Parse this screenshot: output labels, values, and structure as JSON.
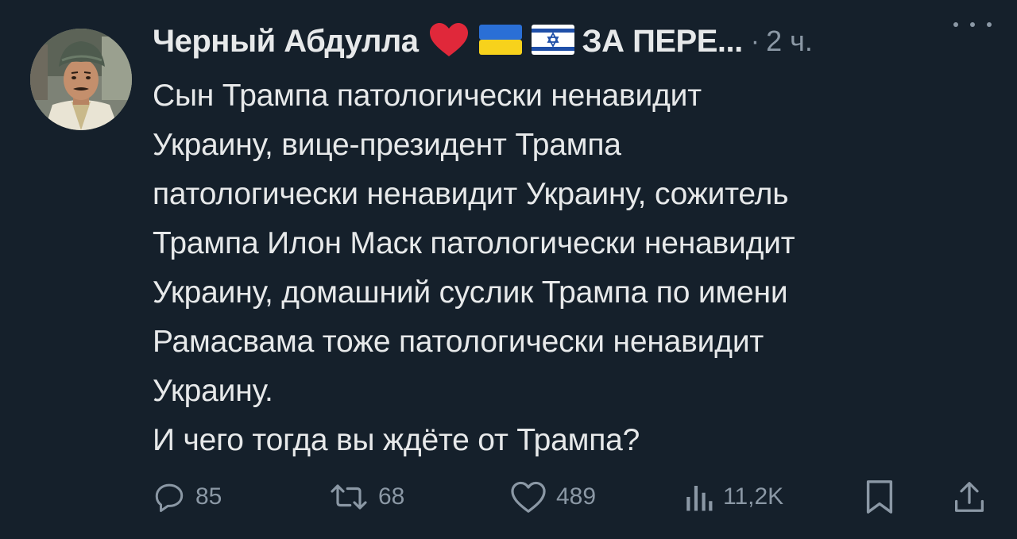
{
  "author": {
    "display_name": "Черный Абдулла",
    "name_suffix": "ЗА ПЕРЕ...",
    "name_emojis": [
      "red-heart",
      "ukraine-flag",
      "israel-flag"
    ],
    "avatar": "man-in-turban-photo"
  },
  "meta": {
    "separator": "·",
    "timestamp": "2 ч."
  },
  "tweet_text": "Сын Трампа патологически ненавидит\nУкраину, вице-президент Трампа\nпатологически ненавидит Украину, сожитель\nТрампа Илон Маск патологически ненавидит\nУкраину, домашний суслик Трампа по имени\nРамасвама тоже патологически ненавидит\nУкраину.\nИ чего тогда вы ждёте от Трампа?",
  "actions": {
    "reply": {
      "icon": "reply-icon",
      "count": "85"
    },
    "retweet": {
      "icon": "retweet-icon",
      "count": "68"
    },
    "like": {
      "icon": "heart-icon",
      "count": "489"
    },
    "views": {
      "icon": "views-icon",
      "count": "11,2K"
    },
    "bookmark": {
      "icon": "bookmark-icon"
    },
    "share": {
      "icon": "share-icon"
    }
  },
  "colors": {
    "background": "#15202b",
    "text_primary": "#e7e9ea",
    "text_secondary": "#8b98a5",
    "heart_red": "#e0283a",
    "ukraine_blue": "#2a6fd6",
    "ukraine_yellow": "#f7d21c",
    "israel_blue": "#1f4fa8"
  }
}
